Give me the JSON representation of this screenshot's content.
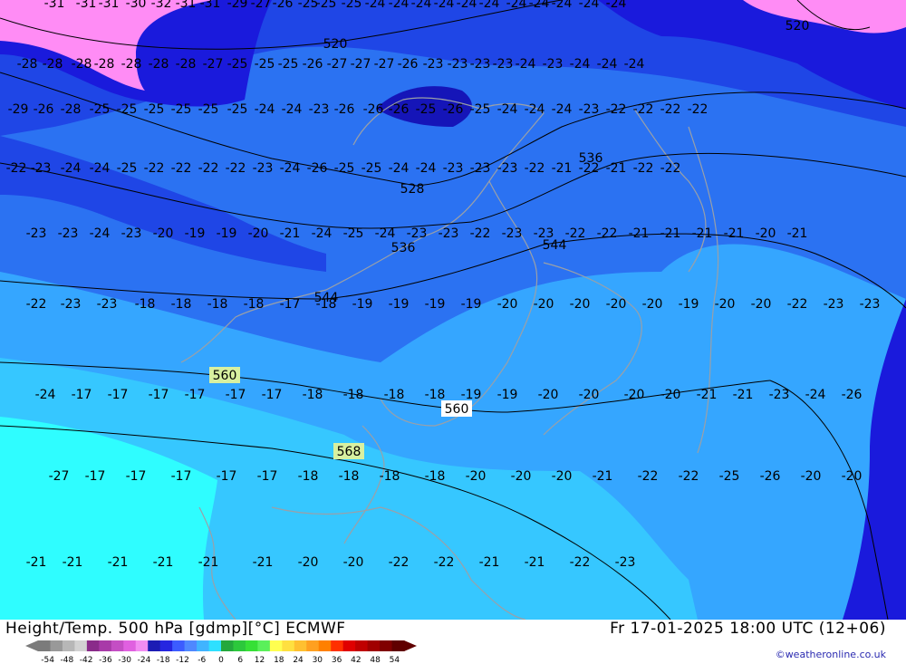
{
  "title": "Height/Temp. 500 hPa [gdmp][°C] ECMWF",
  "valid_time": "Fr 17-01-2025 18:00 UTC (12+06)",
  "credit": "©weatheronline.co.uk",
  "colors": {
    "land_outline": "#9aa0a8",
    "contour": "#000000",
    "label_height_box": "#ffffff",
    "label_highlight_box": "#d8f0a0"
  },
  "legend": {
    "ticks": [
      "-54",
      "-48",
      "-42",
      "-36",
      "-30",
      "-24",
      "-18",
      "-12",
      "-6",
      "0",
      "6",
      "12",
      "18",
      "24",
      "30",
      "36",
      "42",
      "48",
      "54"
    ],
    "colors": [
      "#7b7b7b",
      "#999999",
      "#b7b7b7",
      "#d2d2d2",
      "#8a2b8a",
      "#a83aa8",
      "#c44ec4",
      "#e060e0",
      "#f28cf2",
      "#1c1cb4",
      "#2626e0",
      "#3c5cff",
      "#4f88ff",
      "#40b4ff",
      "#2ee0ff",
      "#24a83c",
      "#2cc83c",
      "#36e036",
      "#5af05a",
      "#ffff50",
      "#ffe040",
      "#ffc030",
      "#ffa020",
      "#ff8000",
      "#ff3000",
      "#e00000",
      "#c00000",
      "#a00000",
      "#800000",
      "#600000"
    ]
  },
  "height_labels": [
    {
      "value": "520"
    },
    {
      "value": "528"
    },
    {
      "value": "536"
    },
    {
      "value": "536"
    },
    {
      "value": "544"
    },
    {
      "value": "544"
    },
    {
      "value": "560"
    },
    {
      "value": "560"
    },
    {
      "value": "568"
    },
    {
      "value": "520"
    }
  ],
  "temp_labels": [
    "-31",
    "-31",
    "-31",
    "-30",
    "-32",
    "-31",
    "-31",
    "-29",
    "-27",
    "-26",
    "-25",
    "-25",
    "-25",
    "-24",
    "-24",
    "-24",
    "-24",
    "-24",
    "-24",
    "-24",
    "-24",
    "-24",
    "-24",
    "-24",
    "-28",
    "-28",
    "-28",
    "-28",
    "-28",
    "-28",
    "-28",
    "-27",
    "-25",
    "-25",
    "-25",
    "-26",
    "-27",
    "-27",
    "-27",
    "-26",
    "-23",
    "-23",
    "-23",
    "-23",
    "-24",
    "-23",
    "-24",
    "-24",
    "-24",
    "-29",
    "-26",
    "-28",
    "-25",
    "-25",
    "-25",
    "-25",
    "-25",
    "-25",
    "-24",
    "-24",
    "-23",
    "-26",
    "-26",
    "-26",
    "-25",
    "-26",
    "-25",
    "-24",
    "-24",
    "-24",
    "-23",
    "-22",
    "-22",
    "-22",
    "-22",
    "-22",
    "-23",
    "-24",
    "-24",
    "-25",
    "-22",
    "-22",
    "-22",
    "-22",
    "-23",
    "-24",
    "-26",
    "-25",
    "-25",
    "-24",
    "-24",
    "-23",
    "-23",
    "-23",
    "-22",
    "-21",
    "-22",
    "-21",
    "-22",
    "-22",
    "-23",
    "-23",
    "-24",
    "-23",
    "-20",
    "-19",
    "-19",
    "-20",
    "-21",
    "-24",
    "-25",
    "-24",
    "-23",
    "-23",
    "-22",
    "-23",
    "-23",
    "-22",
    "-22",
    "-21",
    "-21",
    "-21",
    "-21",
    "-20",
    "-21",
    "-22",
    "-23",
    "-23",
    "-18",
    "-18",
    "-18",
    "-18",
    "-17",
    "-18",
    "-19",
    "-19",
    "-19",
    "-19",
    "-20",
    "-20",
    "-20",
    "-20",
    "-20",
    "-19",
    "-20",
    "-20",
    "-22",
    "-23",
    "-23",
    "-24",
    "-17",
    "-17",
    "-17",
    "-17",
    "-17",
    "-17",
    "-18",
    "-18",
    "-18",
    "-18",
    "-19",
    "-19",
    "-20",
    "-20",
    "-20",
    "-20",
    "-21",
    "-21",
    "-23",
    "-24",
    "-26",
    "-27",
    "-17",
    "-17",
    "-17",
    "-17",
    "-17",
    "-18",
    "-18",
    "-18",
    "-18",
    "-20",
    "-20",
    "-20",
    "-21",
    "-22",
    "-22",
    "-25",
    "-26",
    "-20",
    "-20",
    "-21",
    "-21",
    "-21",
    "-21",
    "-21",
    "-21",
    "-20",
    "-20",
    "-22",
    "-22",
    "-21",
    "-21",
    "-22",
    "-23"
  ]
}
